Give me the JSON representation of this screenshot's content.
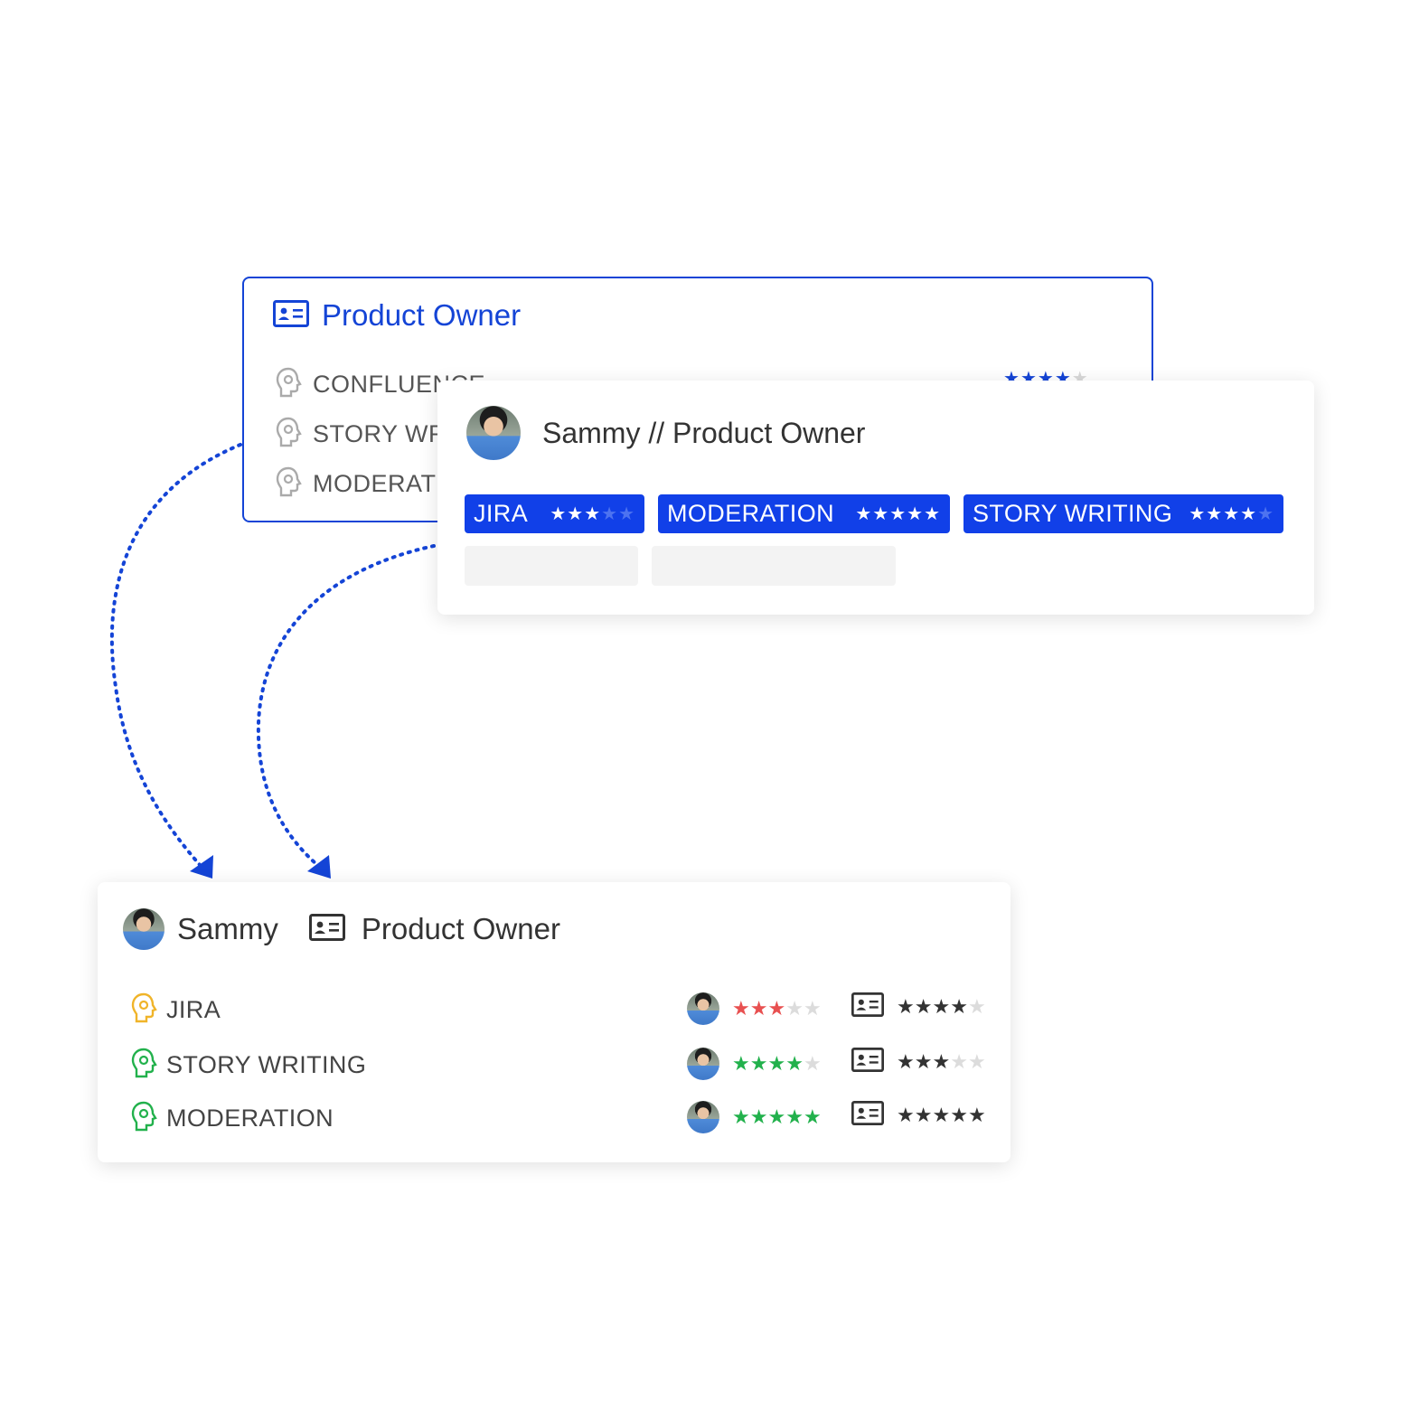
{
  "colors": {
    "brand_blue": "#1444d6",
    "chip_blue": "#1140e8",
    "star_red": "#e85050",
    "star_green": "#22b14c",
    "star_dark": "#333333",
    "skill_icon_yellow": "#f0b429",
    "skill_icon_green": "#22b14c"
  },
  "role_card": {
    "icon": "id-card-icon",
    "title": "Product Owner",
    "skills": [
      {
        "label": "CONFLUENCE",
        "icon": "skill-head-icon"
      },
      {
        "label": "STORY WRITING",
        "icon": "skill-head-icon"
      },
      {
        "label": "MODERATION",
        "icon": "skill-head-icon"
      }
    ],
    "confluence_rating": 4
  },
  "person_card": {
    "avatar": "avatar-photo",
    "title": "Sammy // Product Owner",
    "chips": [
      {
        "label": "JIRA",
        "rating": 3,
        "max": 5
      },
      {
        "label": "MODERATION",
        "rating": 5,
        "max": 5
      },
      {
        "label": "STORY WRITING",
        "rating": 4,
        "max": 5
      }
    ]
  },
  "summary_card": {
    "person_name": "Sammy",
    "role_name": "Product Owner",
    "rows": [
      {
        "skill": "JIRA",
        "icon_color": "yellow",
        "person_rating": 3,
        "person_star_color": "red",
        "role_rating": 4
      },
      {
        "skill": "STORY WRITING",
        "icon_color": "green",
        "person_rating": 4,
        "person_star_color": "green",
        "role_rating": 3
      },
      {
        "skill": "MODERATION",
        "icon_color": "green",
        "person_rating": 5,
        "person_star_color": "green",
        "role_rating": 5
      }
    ]
  }
}
